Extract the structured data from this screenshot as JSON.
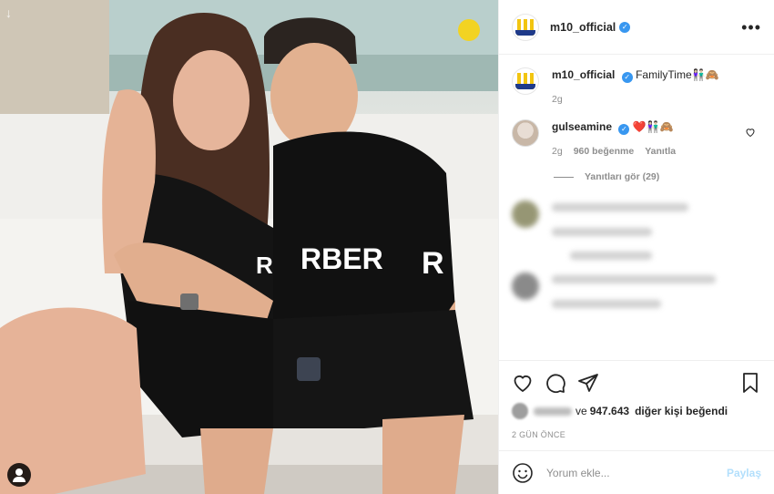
{
  "post": {
    "author": "m10_official",
    "verified": true,
    "caption_text": "FamilyTime",
    "caption_emoji": "👫🏻🙈",
    "caption_age": "2g",
    "more_icon": "more-horizontal-icon"
  },
  "comments": [
    {
      "username": "gulseamine",
      "verified": true,
      "text_emoji": "❤️👫🏻🙈",
      "age": "2g",
      "likes": "960 beğenme",
      "reply": "Yanıtla",
      "view_replies": "Yanıtları gör (29)"
    }
  ],
  "actions": {
    "liked_by_suffix": "ve",
    "likes_count": "947.643",
    "likes_tail": "diğer kişi beğendi",
    "time_ago": "2 GÜN ÖNCE"
  },
  "composer": {
    "placeholder": "Yorum ekle...",
    "post_label": "Paylaş"
  },
  "colors": {
    "verified_blue": "#3897f0",
    "meta_gray": "#8e8e8e",
    "post_button_disabled": "#b2dffc",
    "heart_red": "#ed4956"
  }
}
